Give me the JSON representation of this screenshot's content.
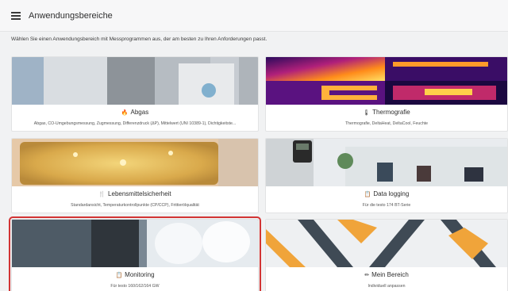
{
  "header": {
    "title": "Anwendungsbereiche",
    "menu_icon": "hamburger-menu-icon"
  },
  "intro": "Wählen Sie einen Anwendungsbereich mit Messprogrammen aus, der am besten zu Ihren Anforderungen passt.",
  "cards": [
    {
      "title": "Abgas",
      "icon": "flame-icon",
      "icon_glyph": "🔥",
      "description": "Abgas, CO-Umgebungsmessung, Zugmessung, Differenzdruck (ΔP), Mittelwert (UNI 10389-1), Dichtigkeitste..."
    },
    {
      "title": "Thermografie",
      "icon": "thermometer-icon",
      "icon_glyph": "🌡",
      "description": "Thermografie, DeltaHeat, DeltaCool, Feuchte"
    },
    {
      "title": "Lebensmittelsicherheit",
      "icon": "fork-knife-icon",
      "icon_glyph": "🍴",
      "description": "Standardansicht, Temperaturkontrollpunkte (CP/CCP), Frittierölqualität"
    },
    {
      "title": "Data logging",
      "icon": "clipboard-icon",
      "icon_glyph": "📋",
      "description": "Für die testo 174 BT-Serie"
    },
    {
      "title": "Monitoring",
      "icon": "clipboard-icon",
      "icon_glyph": "📋",
      "description": "Für testo 160/162/164 GW"
    },
    {
      "title": "Mein Bereich",
      "icon": "pencil-icon",
      "icon_glyph": "✏",
      "description": "Individuell anpassen"
    }
  ],
  "selected_card": "Monitoring",
  "colors": {
    "selection_outline": "#d23434",
    "background": "#f1f2f3"
  }
}
